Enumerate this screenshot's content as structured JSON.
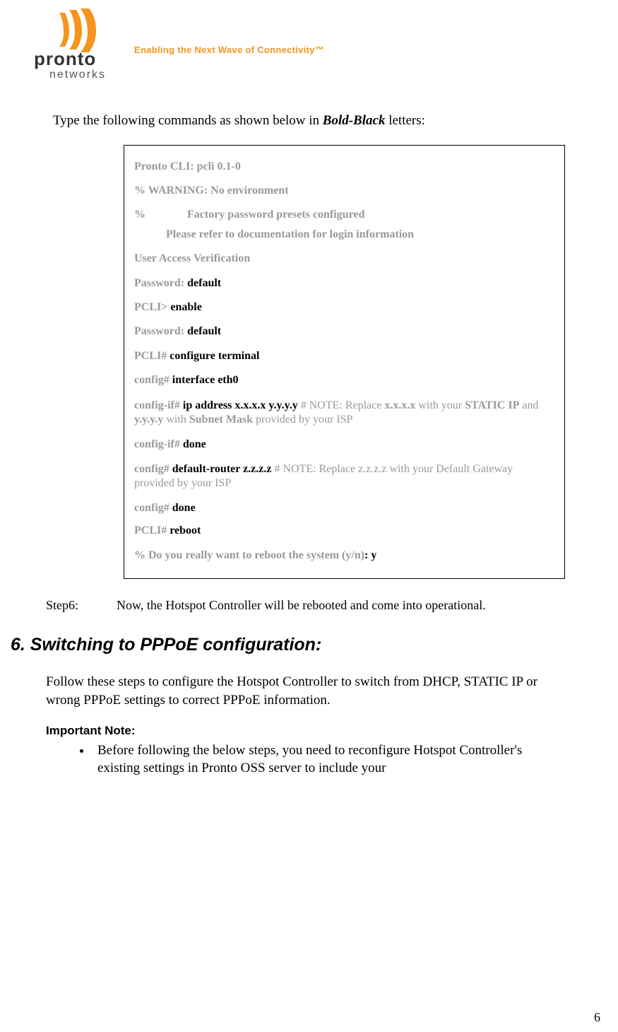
{
  "header": {
    "logo_main": "pronto",
    "logo_sub": "networks",
    "tagline": "Enabling the Next Wave of Connectivity™"
  },
  "intro": {
    "prefix": "Type the following commands as shown below in ",
    "emph": "Bold-Black",
    "suffix": " letters:"
  },
  "cli": {
    "l1": "Pronto CLI: pcli 0.1-0",
    "l2": "% WARNING: No environment",
    "l3a": "%",
    "l3b": "Factory password presets configured",
    "l3c": "Please refer to documentation for login information",
    "l4": "User Access Verification",
    "l5a": "Password: ",
    "l5b": "default",
    "l6a": "PCLI> ",
    "l6b": "enable",
    "l7a": "Password: ",
    "l7b": "default",
    "l8a": "PCLI#  ",
    "l8b": "configure terminal",
    "l9a": "config#  ",
    "l9b": "interface eth0",
    "l10a": "config-if#  ",
    "l10b": "ip address  x.x.x.x  y.y.y.y",
    "l10c": "   # NOTE: Replace ",
    "l10d": "x.x.x.x",
    "l10e": " with your ",
    "l10f": "STATIC IP",
    "l10g": " and ",
    "l10h": "y.y.y.y",
    "l10i": " with ",
    "l10j": "Subnet Mask",
    "l10k": " provided by your ISP",
    "l11a": "config-if# ",
    "l11b": "done",
    "l12a": "config#  ",
    "l12b": "default-router  z.z.z.z",
    "l12c": "     # NOTE: Replace z.z.z.z with your Default Gateway provided by your ISP",
    "l13a": "config# ",
    "l13b": "done",
    "l14a": "PCLI# ",
    "l14b": "reboot",
    "l15a": " % Do you really want to reboot the system (y/n)",
    "l15b": ": y"
  },
  "step6": {
    "label": "Step6:",
    "text": "Now, the Hotspot Controller will be rebooted and come into operational."
  },
  "section6": {
    "heading": "6. Switching to PPPoE configuration:",
    "para": "Follow these steps to configure the Hotspot Controller to switch from DHCP, STATIC IP or wrong PPPoE settings to correct PPPoE information.",
    "note_head": "Important Note:",
    "note_bullet": "Before following the below steps, you need to reconfigure Hotspot Controller's existing settings in Pronto OSS server to include your"
  },
  "page_number": "6"
}
